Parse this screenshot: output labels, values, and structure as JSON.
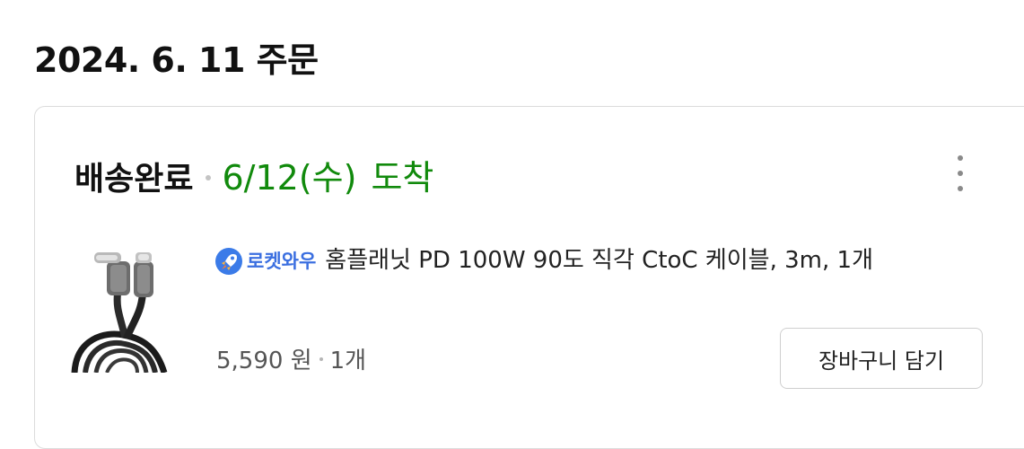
{
  "order": {
    "date_heading": "2024. 6. 11 주문"
  },
  "shipment": {
    "status": "배송완료",
    "date": "6/12(수)",
    "arrival_label": "도착",
    "status_color": "#118a0c"
  },
  "product": {
    "badge_label": "로켓와우",
    "badge_icon": "rocket-icon",
    "name": "홈플래닛 PD 100W 90도 직각 CtoC 케이블, 3m, 1개",
    "price": "5,590 원",
    "quantity": "1개",
    "image": "usb-c-cable-image"
  },
  "actions": {
    "add_to_cart": "장바구니 담기",
    "more_icon": "more-vertical-icon"
  }
}
